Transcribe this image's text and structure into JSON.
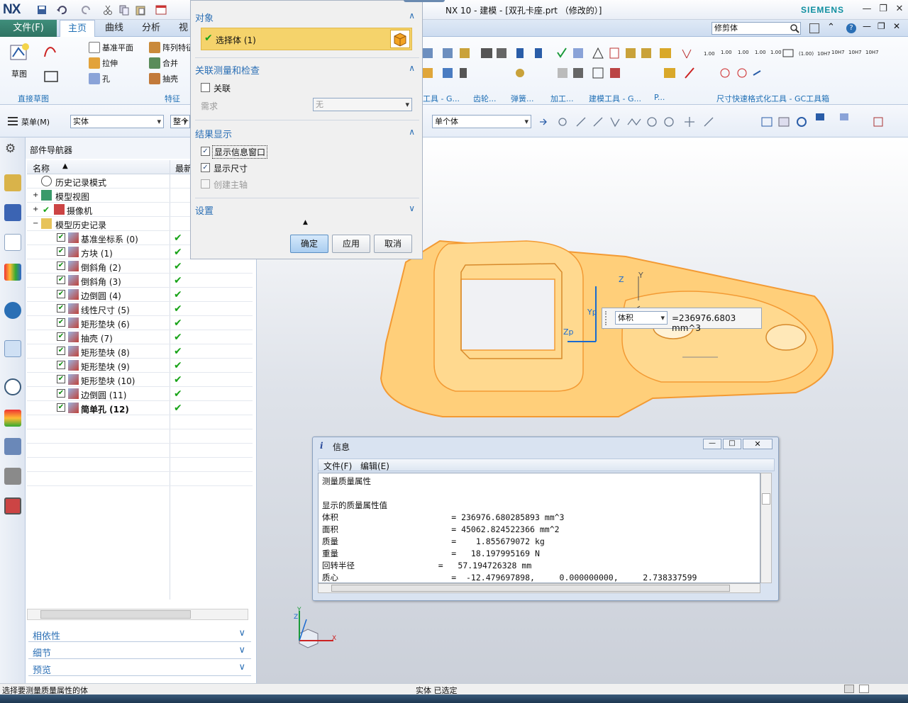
{
  "app": {
    "logo": "NX",
    "title": "NX 10 - 建模 - [双孔卡座.prt （修改的）]",
    "brand": "SIEMENS"
  },
  "menubar": {
    "file": "文件(F)",
    "tabs": [
      "主页",
      "曲线",
      "分析",
      "视"
    ],
    "search_value": "修剪体"
  },
  "ribbon": {
    "sketch_label": "草图",
    "group_direct_sketch": "直接草图",
    "datum_plane": "基准平面",
    "array": "阵列特征",
    "extrude": "拉伸",
    "merge": "合并",
    "hole": "孔",
    "shell": "抽壳",
    "group_feature": "特征",
    "group_labels_right": [
      "工具 - G...",
      "齿轮...",
      "弹簧...",
      "加工...",
      "建模工具 - G...",
      "P..."
    ],
    "group_dim": "尺寸快速格式化工具 - GC工具箱",
    "dim_labels": [
      "1.00",
      "1.00",
      "1.00",
      "1.00",
      "1.00",
      "(1.00)",
      "10H7",
      "10H7",
      "10H7",
      "10H7"
    ]
  },
  "toolbar": {
    "menu_label": "菜单(M)",
    "filter_value": "实体",
    "assembly_value": "整个装",
    "select_value": "单个体"
  },
  "navigator": {
    "title": "部件导航器",
    "col_name": "名称",
    "col_latest": "最新",
    "top_items": [
      {
        "label": "历史记录模式"
      },
      {
        "label": "模型视图"
      },
      {
        "label": "摄像机"
      },
      {
        "label": "模型历史记录"
      }
    ],
    "features": [
      {
        "label": "基准坐标系 (0)",
        "bold": false
      },
      {
        "label": "方块 (1)",
        "bold": false
      },
      {
        "label": "倒斜角 (2)",
        "bold": false
      },
      {
        "label": "倒斜角 (3)",
        "bold": false
      },
      {
        "label": "边倒圆 (4)",
        "bold": false
      },
      {
        "label": "线性尺寸 (5)",
        "bold": false
      },
      {
        "label": "矩形垫块 (6)",
        "bold": false
      },
      {
        "label": "抽壳 (7)",
        "bold": false
      },
      {
        "label": "矩形垫块 (8)",
        "bold": false
      },
      {
        "label": "矩形垫块 (9)",
        "bold": false
      },
      {
        "label": "矩形垫块 (10)",
        "bold": false
      },
      {
        "label": "边倒圆 (11)",
        "bold": false
      },
      {
        "label": "简单孔 (12)",
        "bold": true
      }
    ],
    "sections": [
      "相依性",
      "细节",
      "预览"
    ]
  },
  "dialog": {
    "section_object": "对象",
    "select_body": "选择体 (1)",
    "section_measure": "关联测量和检查",
    "associative": "关联",
    "requirement_label": "需求",
    "requirement_value": "无",
    "section_result": "结果显示",
    "show_info": "显示信息窗口",
    "show_dims": "显示尺寸",
    "create_axes": "创建主轴",
    "section_settings": "设置",
    "ok": "确定",
    "apply": "应用",
    "cancel": "取消"
  },
  "viewport": {
    "dim_type": "体积",
    "dim_value": "=236976.6803 mm^3",
    "axes": {
      "zc": "Zc",
      "yc": "Yc",
      "xc": "Xc",
      "z": "Z",
      "y": "Y",
      "x": "X",
      "zp": "Zp",
      "yp": "Yp"
    }
  },
  "info_window": {
    "title": "信息",
    "menu_file": "文件(F)",
    "menu_edit": "编辑(E)",
    "lines": [
      "测量质量属性",
      "",
      "显示的质量属性值",
      "体积                       = 236976.680285893 mm^3",
      "面积                       = 45062.824522366 mm^2",
      "质量                       =    1.855679072 kg",
      "重量                       =   18.197995169 N",
      "回转半径                 =   57.194726328 mm",
      "质心                       =  -12.479697898,     0.000000000,     2.738337599"
    ]
  },
  "status": {
    "prompt": "选择要测量质量属性的体",
    "selection": "实体 已选定"
  },
  "colors": {
    "accent": "#2b6fb5",
    "file_tab": "#2f7363",
    "model": "#ffc25a",
    "highlight": "#f5d36b",
    "ok_green": "#17a317"
  }
}
